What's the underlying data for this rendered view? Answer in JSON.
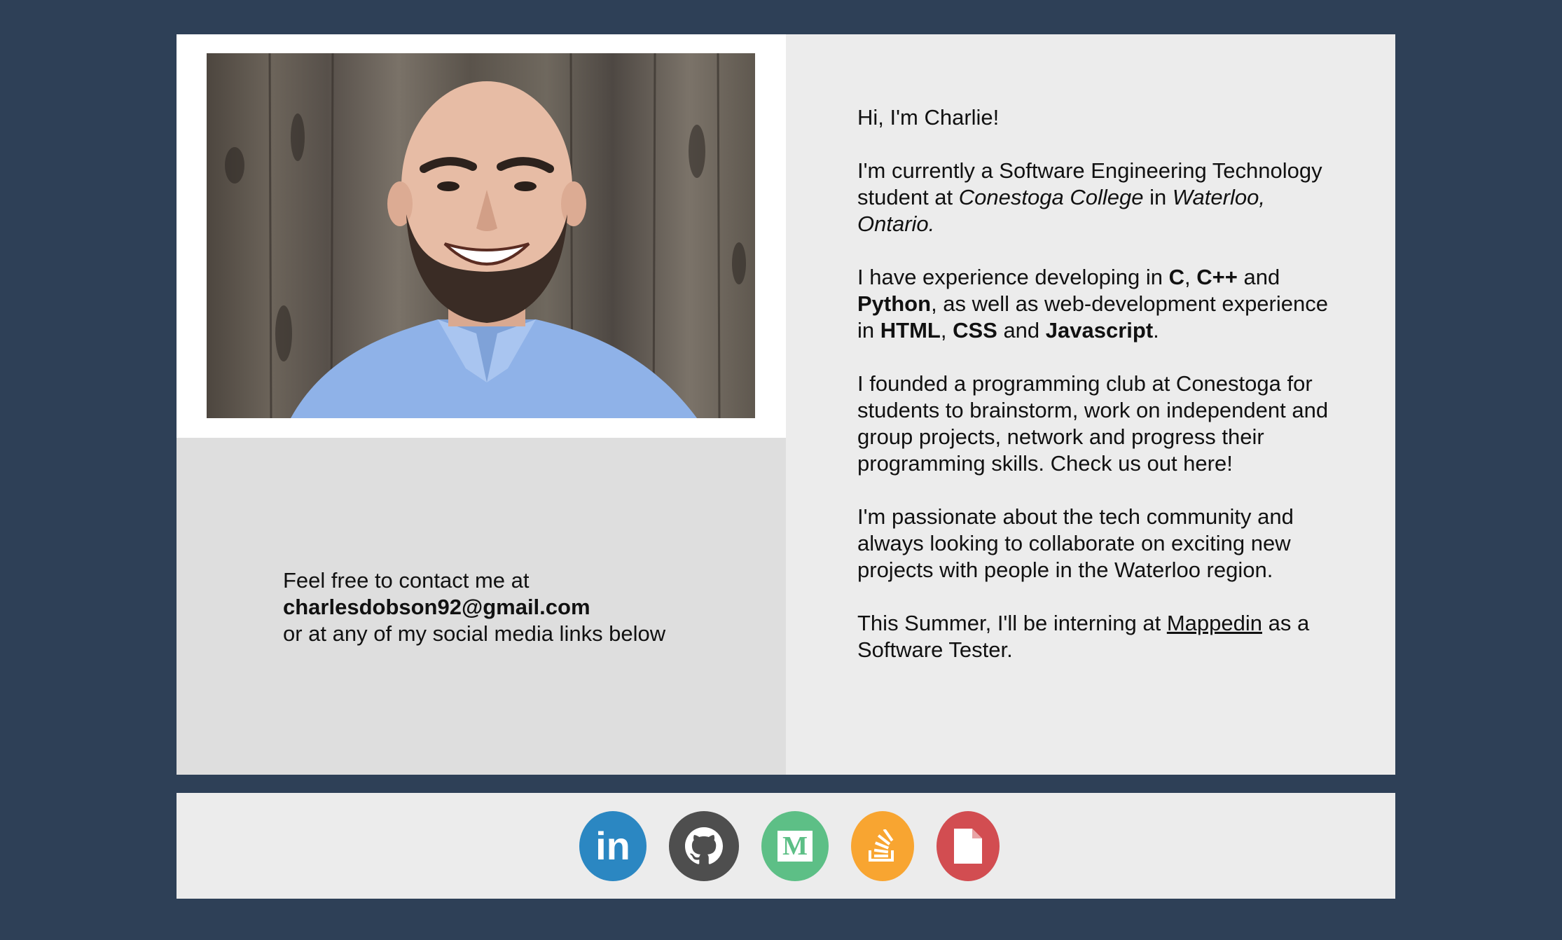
{
  "profile": {
    "photo_alt": "Profile photo"
  },
  "contact": {
    "line1": "Feel free to contact me at",
    "email": "charlesdobson92@gmail.com",
    "line3": "or at any of my social media links below"
  },
  "bio": {
    "greeting": "Hi, I'm Charlie!",
    "p2": {
      "t1": "I'm currently a Software Engineering Technology student at ",
      "college": "Conestoga College",
      "t2": " in ",
      "location": "Waterloo, Ontario."
    },
    "p3": {
      "t1": "I have experience developing in ",
      "c": "C",
      "t2": ", ",
      "cpp": "C++",
      "t3": " and ",
      "python": "Python",
      "t4": ", as well as web-development experience in ",
      "html": "HTML",
      "t5": ", ",
      "css": "CSS",
      "t6": " and ",
      "js": "Javascript",
      "t7": "."
    },
    "p4": "I founded a programming club at Conestoga for students to brainstorm, work on independent and group projects, network and progress their programming skills. Check us out here!",
    "p5": "I'm passionate about the tech community and always looking to collaborate on exciting new projects with people in the Waterloo region.",
    "p6": {
      "t1": "This Summer, I'll be interning at ",
      "company": "Mappedin",
      "t2": " as a Software Tester."
    }
  },
  "social": [
    {
      "name": "linkedin-icon",
      "color": "#2b87c2",
      "glyph": "in"
    },
    {
      "name": "github-icon",
      "color": "#4e4e4e"
    },
    {
      "name": "medium-icon",
      "color": "#5dbf86",
      "glyph": "M"
    },
    {
      "name": "stackoverflow-icon",
      "color": "#f8a531"
    },
    {
      "name": "resume-icon",
      "color": "#d24d51"
    }
  ]
}
